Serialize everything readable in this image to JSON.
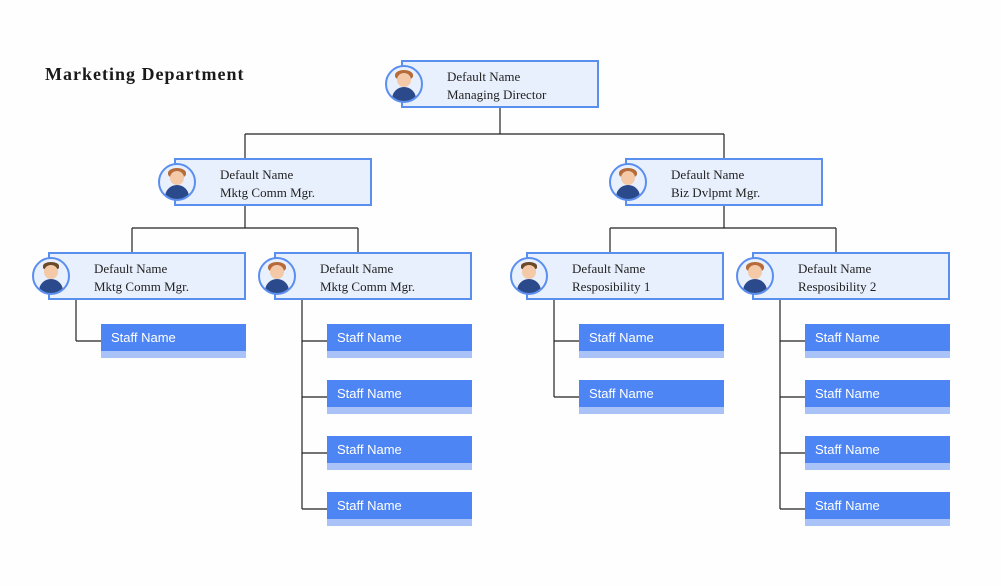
{
  "title": "Marketing Department",
  "root": {
    "name": "Default Name",
    "role": "Managing Director"
  },
  "level2": [
    {
      "name": "Default Name",
      "role": "Mktg Comm Mgr."
    },
    {
      "name": "Default Name",
      "role": "Biz Dvlpmt Mgr."
    }
  ],
  "level3": [
    {
      "name": "Default Name",
      "role": "Mktg Comm Mgr."
    },
    {
      "name": "Default Name",
      "role": "Mktg Comm Mgr."
    },
    {
      "name": "Default Name",
      "role": "Resposibility 1"
    },
    {
      "name": "Default Name",
      "role": "Resposibility 2"
    }
  ],
  "staff_label": "Staff Name",
  "staff_counts": [
    1,
    4,
    2,
    4
  ]
}
